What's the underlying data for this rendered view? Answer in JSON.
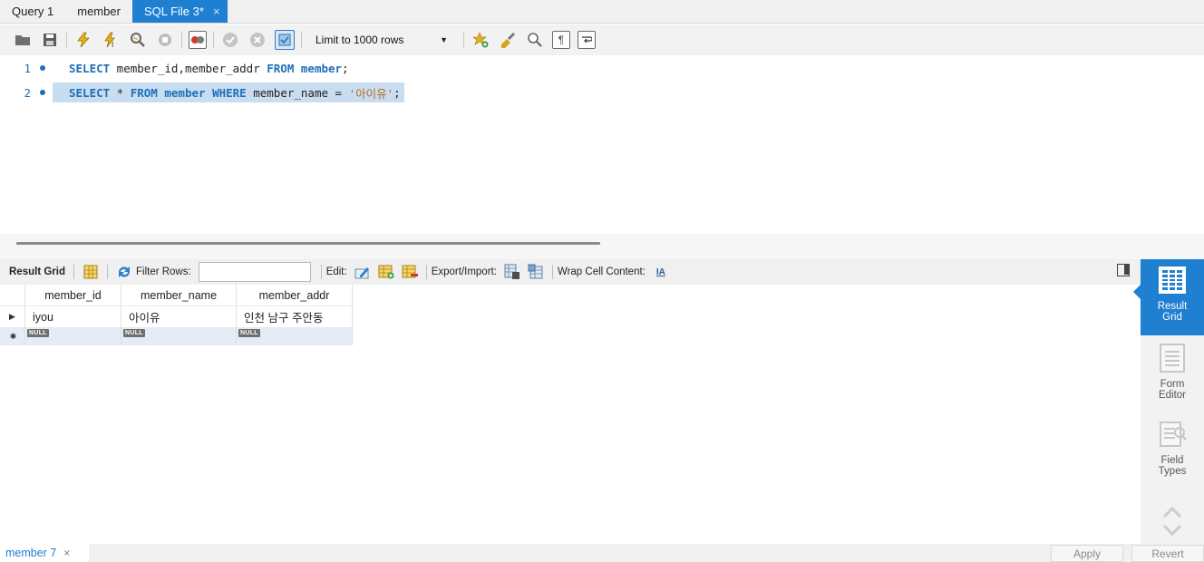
{
  "tabs": [
    {
      "label": "Query 1",
      "active": false
    },
    {
      "label": "member",
      "active": false
    },
    {
      "label": "SQL File 3*",
      "active": true,
      "close_icon": "×"
    }
  ],
  "toolbar": {
    "limit_label": "Limit to 1000 rows",
    "icons": [
      "open-folder-icon",
      "save-icon",
      "execute-icon",
      "execute-current-icon",
      "explain-icon",
      "stop-icon",
      "toggle-error-icon",
      "commit-icon",
      "rollback-icon",
      "autocommit-icon",
      "add-snippet-icon",
      "beautify-icon",
      "find-icon",
      "invisible-chars-icon",
      "wrap-icon"
    ]
  },
  "editor": {
    "lines": [
      {
        "num": "1",
        "tokens": [
          {
            "t": "SELECT",
            "k": "kw"
          },
          {
            "t": " member_id,member_addr ",
            "k": ""
          },
          {
            "t": "FROM",
            "k": "kw"
          },
          {
            "t": " ",
            "k": ""
          },
          {
            "t": "member",
            "k": "kw"
          },
          {
            "t": ";",
            "k": ""
          }
        ]
      },
      {
        "num": "2",
        "tokens": [
          {
            "t": "SELECT",
            "k": "kw"
          },
          {
            "t": " * ",
            "k": ""
          },
          {
            "t": "FROM",
            "k": "kw"
          },
          {
            "t": " ",
            "k": ""
          },
          {
            "t": "member",
            "k": "kw"
          },
          {
            "t": " ",
            "k": ""
          },
          {
            "t": "WHERE",
            "k": "kw"
          },
          {
            "t": " member_name = ",
            "k": ""
          },
          {
            "t": "'아이유'",
            "k": "str"
          },
          {
            "t": ";",
            "k": ""
          }
        ]
      }
    ]
  },
  "result_toolbar": {
    "result_grid_label": "Result Grid",
    "filter_label": "Filter Rows:",
    "filter_value": "",
    "edit_label": "Edit:",
    "export_label": "Export/Import:",
    "wrap_label": "Wrap Cell Content:",
    "wrap_icon_text": "IA"
  },
  "grid": {
    "columns": [
      "member_id",
      "member_name",
      "member_addr"
    ],
    "rows": [
      [
        "iyou",
        "아이유",
        "인천 남구 주안동"
      ]
    ],
    "null_label": "NULL",
    "current_row_marker": "▶",
    "new_row_marker": "✱"
  },
  "side_panel": {
    "items": [
      {
        "label": "Result Grid",
        "active": true
      },
      {
        "label": "Form Editor",
        "active": false
      },
      {
        "label": "Field Types",
        "active": false
      }
    ]
  },
  "bottom": {
    "result_tab_label": "member 7",
    "close_icon": "×",
    "apply_label": "Apply",
    "revert_label": "Revert"
  },
  "colors": {
    "accent": "#1f7fd0",
    "keyword": "#1e6fb8",
    "string": "#b06b20",
    "selection": "#c9ddf1"
  }
}
